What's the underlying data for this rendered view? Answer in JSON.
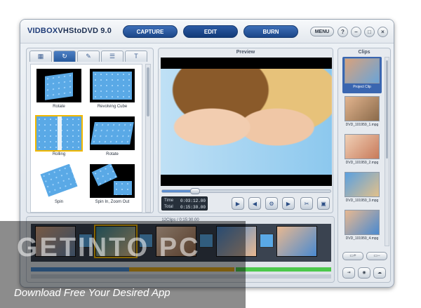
{
  "app": {
    "logo_brand": "VIDBOX",
    "logo_product": "VHStoDVD",
    "logo_version": "9.0"
  },
  "modes": [
    "CAPTURE",
    "EDIT",
    "BURN"
  ],
  "active_mode": "EDIT",
  "window_buttons": {
    "menu": "MENU",
    "help": "?",
    "minimize": "–",
    "maximize": "□",
    "close": "×"
  },
  "effects_tabs": [
    "grid-icon",
    "transition-icon",
    "wand-icon",
    "sliders-icon",
    "text-icon"
  ],
  "effects": [
    {
      "label": "Rotate"
    },
    {
      "label": "Revolving Cube"
    },
    {
      "label": "Rolling",
      "selected": true
    },
    {
      "label": "Rotate"
    },
    {
      "label": "Spin"
    },
    {
      "label": "Spin In, Zoom Out"
    }
  ],
  "preview": {
    "title": "Preview",
    "time_label": "Time",
    "time_value": "0:03:12.00",
    "total_label": "Total",
    "total_value": "0:15:30.00",
    "progress": 0.2,
    "controls": [
      "play-icon",
      "step-back-icon",
      "settings-icon",
      "step-forward-icon",
      "scissors-icon",
      "save-icon"
    ]
  },
  "clips": {
    "title": "Clips",
    "items": [
      {
        "label": "Project Clip",
        "selected": true
      },
      {
        "label": "DVD_101959_1.mpg"
      },
      {
        "label": "DVD_101959_2.mpg"
      },
      {
        "label": "DVD_101959_3.mpg"
      },
      {
        "label": "DVD_101959_4.mpg"
      }
    ]
  },
  "timeline": {
    "timecode": "12Clips / 0:15:30.00",
    "clip_count": 7
  },
  "watermark": {
    "title": "GETINTO PC",
    "subtitle": "Download Free Your Desired App"
  }
}
